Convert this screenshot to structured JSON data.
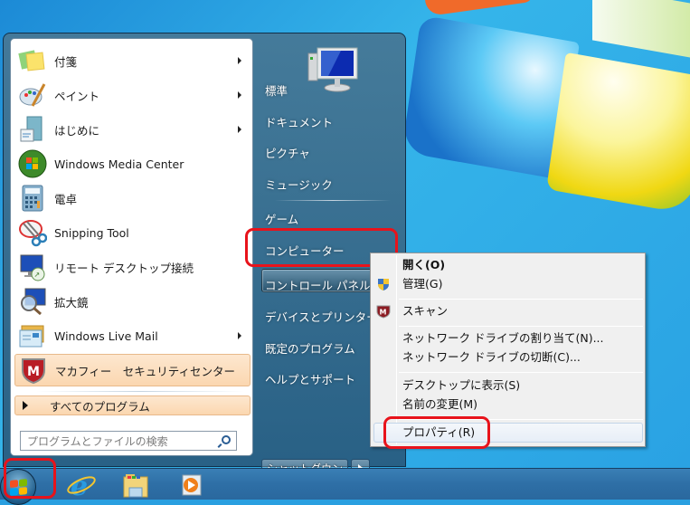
{
  "start_menu": {
    "programs": [
      {
        "label": "付箋",
        "icon": "sticky-notes-icon",
        "has_submenu": true
      },
      {
        "label": "ペイント",
        "icon": "paint-icon",
        "has_submenu": true
      },
      {
        "label": "はじめに",
        "icon": "getting-started-icon",
        "has_submenu": true
      },
      {
        "label": "Windows Media Center",
        "icon": "media-center-icon",
        "has_submenu": false
      },
      {
        "label": "電卓",
        "icon": "calculator-icon",
        "has_submenu": false
      },
      {
        "label": "Snipping Tool",
        "icon": "snipping-tool-icon",
        "has_submenu": false
      },
      {
        "label": "リモート デスクトップ接続",
        "icon": "remote-desktop-icon",
        "has_submenu": false
      },
      {
        "label": "拡大鏡",
        "icon": "magnifier-icon",
        "has_submenu": false
      },
      {
        "label": "Windows Live Mail",
        "icon": "mail-icon",
        "has_submenu": true
      },
      {
        "label": "マカフィー　セキュリティセンター",
        "icon": "mcafee-icon",
        "has_submenu": false
      }
    ],
    "all_programs_label": "すべてのプログラム",
    "search_placeholder": "プログラムとファイルの検索",
    "right_items": [
      {
        "label": "標準"
      },
      {
        "label": "ドキュメント"
      },
      {
        "label": "ピクチャ"
      },
      {
        "label": "ミュージック"
      },
      {
        "label": "ゲーム"
      },
      {
        "label": "コンピューター"
      },
      {
        "label": "コントロール パネル"
      },
      {
        "label": "デバイスとプリンター"
      },
      {
        "label": "既定のプログラム"
      },
      {
        "label": "ヘルプとサポート"
      }
    ],
    "shutdown_label": "シャットダウン"
  },
  "context_menu": {
    "items": [
      {
        "label": "開く(O)",
        "bold": true
      },
      {
        "label": "管理(G)",
        "icon": "uac-shield-icon"
      },
      {
        "label": "スキャン",
        "icon": "mcafee-icon"
      },
      {
        "label": "ネットワーク ドライブの割り当て(N)..."
      },
      {
        "label": "ネットワーク ドライブの切断(C)..."
      },
      {
        "label": "デスクトップに表示(S)"
      },
      {
        "label": "名前の変更(M)"
      },
      {
        "label": "プロパティ(R)",
        "highlighted": true
      }
    ]
  },
  "taskbar": {
    "items": [
      "start-orb",
      "internet-explorer",
      "windows-explorer",
      "media-player"
    ]
  },
  "colors": {
    "highlight_box": "#e8131b",
    "desktop_blue": "#2aa2e3",
    "pinned_bg": "#fbd7b0"
  }
}
